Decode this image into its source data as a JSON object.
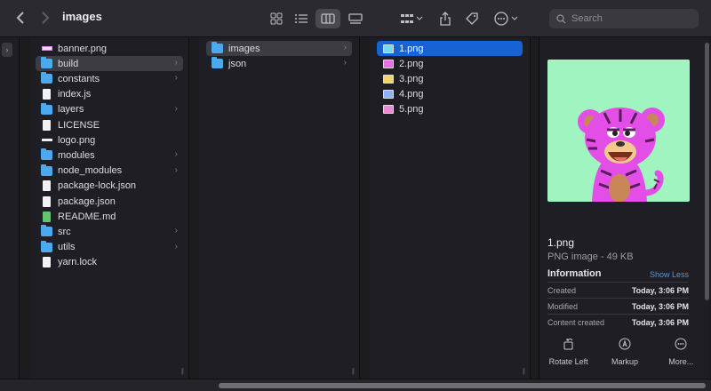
{
  "window": {
    "title": "images"
  },
  "search": {
    "placeholder": "Search"
  },
  "column1": {
    "items": [
      {
        "label": "banner.png",
        "type": "banner",
        "chevron": false
      },
      {
        "label": "build",
        "type": "folder",
        "chevron": true,
        "selected": true
      },
      {
        "label": "constants",
        "type": "folder",
        "chevron": true
      },
      {
        "label": "index.js",
        "type": "doc",
        "chevron": false
      },
      {
        "label": "layers",
        "type": "folder",
        "chevron": true
      },
      {
        "label": "LICENSE",
        "type": "doc",
        "chevron": false
      },
      {
        "label": "logo.png",
        "type": "logo",
        "chevron": false
      },
      {
        "label": "modules",
        "type": "folder",
        "chevron": true
      },
      {
        "label": "node_modules",
        "type": "folder",
        "chevron": true
      },
      {
        "label": "package-lock.json",
        "type": "doc",
        "chevron": false
      },
      {
        "label": "package.json",
        "type": "doc",
        "chevron": false
      },
      {
        "label": "README.md",
        "type": "doc-green",
        "chevron": false
      },
      {
        "label": "src",
        "type": "folder",
        "chevron": true
      },
      {
        "label": "utils",
        "type": "folder",
        "chevron": true
      },
      {
        "label": "yarn.lock",
        "type": "doc",
        "chevron": false
      }
    ]
  },
  "column2": {
    "items": [
      {
        "label": "images",
        "type": "folder",
        "chevron": true,
        "selected": true
      },
      {
        "label": "json",
        "type": "folder",
        "chevron": true
      }
    ]
  },
  "column3": {
    "items": [
      {
        "label": "1.png",
        "color": "#7ad9e8",
        "active": true
      },
      {
        "label": "2.png",
        "color": "#e86fe0"
      },
      {
        "label": "3.png",
        "color": "#f0d36a"
      },
      {
        "label": "4.png",
        "color": "#8fb2f0"
      },
      {
        "label": "5.png",
        "color": "#f08ad0"
      }
    ]
  },
  "preview": {
    "name": "1.png",
    "kind": "PNG image - 49 KB",
    "info_heading": "Information",
    "toggle_label": "Show Less",
    "metadata": [
      {
        "label": "Created",
        "value": "Today, 3:06 PM"
      },
      {
        "label": "Modified",
        "value": "Today, 3:06 PM"
      },
      {
        "label": "Content created",
        "value": "Today, 3:06 PM"
      }
    ],
    "actions": [
      {
        "label": "Rotate Left",
        "icon": "rotate-left-icon"
      },
      {
        "label": "Markup",
        "icon": "markup-icon"
      },
      {
        "label": "More...",
        "icon": "more-icon"
      }
    ]
  },
  "colors": {
    "accent": "#1763d6",
    "folder": "#4ba9f0",
    "thumb_bg": "#9ff4c0",
    "tiger": "#e34fe6"
  }
}
